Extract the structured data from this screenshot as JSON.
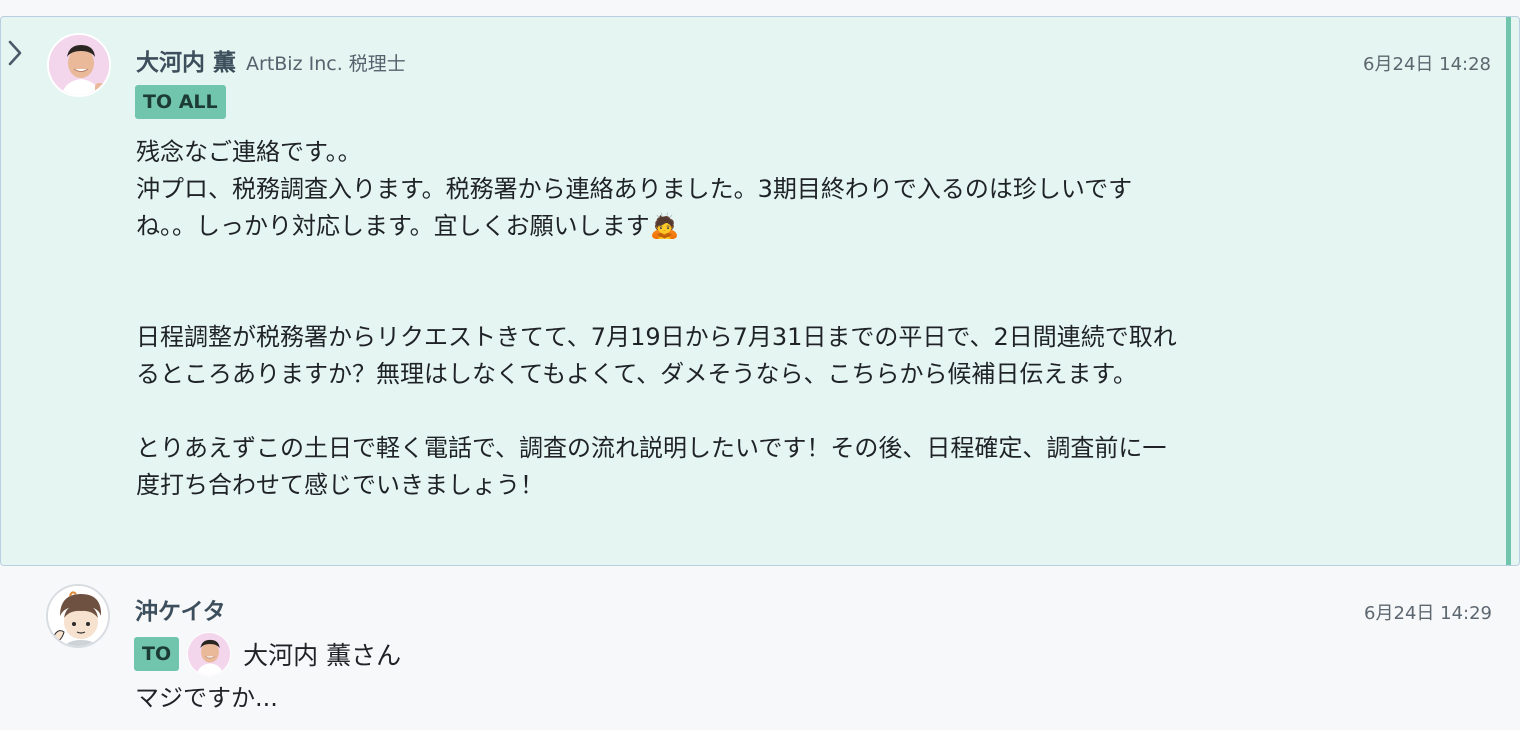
{
  "messages": [
    {
      "sender": "大河内 薫",
      "org": "ArtBiz Inc. 税理士",
      "time": "6月24日 14:28",
      "badge": "TO ALL",
      "body": "残念なご連絡です。。\n沖プロ、税務調査入ります。税務署から連絡ありました。3期目終わりで入るのは珍しいです\nね。。しっかり対応します。宜しくお願いします🙇\n\n\n日程調整が税務署からリクエストきてて、7月19日から7月31日までの平日で、2日間連続で取れ\nるところありますか？無理はしなくてもよくて、ダメそうなら、こちらから候補日伝えます。\n\nとりあえずこの土日で軽く電話で、調査の流れ説明したいです！その後、日程確定、調査前に一\n度打ち合わせて感じでいきましょう！",
      "highlighted": true
    },
    {
      "sender": "沖ケイタ",
      "time": "6月24日 14:29",
      "badge": "TO",
      "to_name": "大河内 薫さん",
      "body": "マジですか..."
    }
  ],
  "icons": {
    "expand": "chevron-right-icon"
  },
  "colors": {
    "highlight_bg": "#e5f5f1",
    "accent": "#72c5ad",
    "name": "#3d4e5c"
  }
}
